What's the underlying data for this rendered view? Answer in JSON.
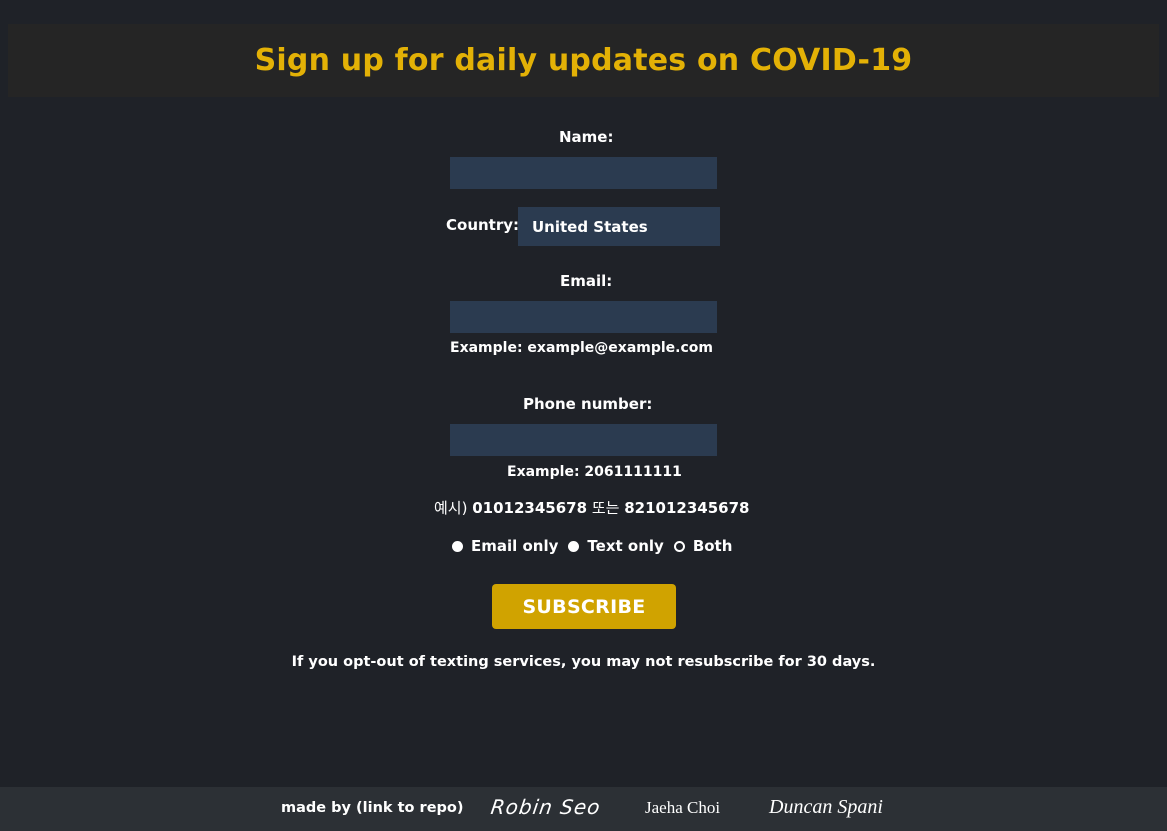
{
  "header": {
    "title": "Sign up for daily updates on COVID-19"
  },
  "form": {
    "name_label": "Name:",
    "name_value": "",
    "country_label": "Country:",
    "country_selected": "United States",
    "email_label": "Email:",
    "email_value": "",
    "email_hint": "Example: example@example.com",
    "phone_label": "Phone number:",
    "phone_value": "",
    "phone_hint": "Example: 2061111111",
    "phone_hint_korean_prefix": "예시)",
    "phone_hint_korean_num1": "01012345678",
    "phone_hint_korean_or": "또는",
    "phone_hint_korean_num2": "821012345678",
    "radio_options": [
      {
        "label": "Email only",
        "selected": false
      },
      {
        "label": "Text only",
        "selected": false
      },
      {
        "label": "Both",
        "selected": true
      }
    ],
    "subscribe_label": "SUBSCRIBE",
    "notice": "If you opt-out of texting services, you may not resubscribe for 30 days."
  },
  "footer": {
    "made_by": "made by (link to repo)",
    "authors": [
      "Robin Seo",
      "Jaeha Choi",
      "Duncan Spani"
    ]
  },
  "colors": {
    "background": "#1f2228",
    "header_bg": "#252525",
    "title": "#e3b106",
    "input_bg": "#2b3b50",
    "button_bg": "#d0a300",
    "footer_bg": "#2c3035"
  }
}
